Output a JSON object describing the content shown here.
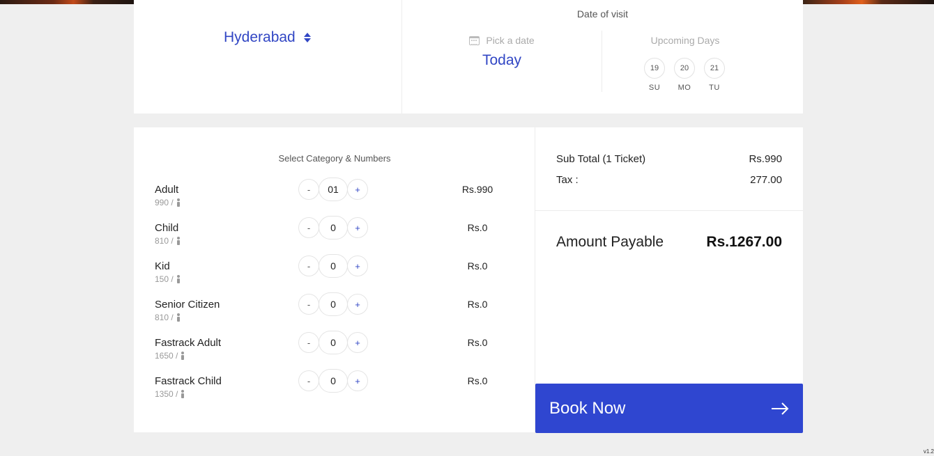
{
  "city": {
    "selected": "Hyderabad"
  },
  "visit": {
    "title": "Date of visit",
    "pick_placeholder": "Pick a date",
    "selected_label": "Today",
    "upcoming_title": "Upcoming Days",
    "upcoming": [
      {
        "date": "19",
        "day": "SU"
      },
      {
        "date": "20",
        "day": "MO"
      },
      {
        "date": "21",
        "day": "TU"
      }
    ]
  },
  "categories": {
    "title": "Select Category & Numbers",
    "minus_label": "-",
    "plus_label": "+",
    "items": [
      {
        "name": "Adult",
        "unit_price": "990 /",
        "count": "01",
        "total": "Rs.990"
      },
      {
        "name": "Child",
        "unit_price": "810 /",
        "count": "0",
        "total": "Rs.0"
      },
      {
        "name": "Kid",
        "unit_price": "150 /",
        "count": "0",
        "total": "Rs.0"
      },
      {
        "name": "Senior Citizen",
        "unit_price": "810 /",
        "count": "0",
        "total": "Rs.0"
      },
      {
        "name": "Fastrack Adult",
        "unit_price": "1650 /",
        "count": "0",
        "total": "Rs.0"
      },
      {
        "name": "Fastrack Child",
        "unit_price": "1350 /",
        "count": "0",
        "total": "Rs.0"
      }
    ]
  },
  "summary": {
    "subtotal_label": "Sub Total (1 Ticket)",
    "subtotal_value": "Rs.990",
    "tax_label": "Tax :",
    "tax_value": "277.00",
    "payable_label": "Amount Payable",
    "payable_value": "Rs.1267.00"
  },
  "book": {
    "label": "Book Now"
  },
  "version": "v1.2",
  "colors": {
    "accent": "#2f46d0",
    "link": "#3146c4",
    "background": "#efefef"
  },
  "icons": {
    "city_toggle": "chevron-updown-icon",
    "calendar": "calendar-icon",
    "person": "person-icon",
    "book_arrow": "arrow-right-icon"
  }
}
